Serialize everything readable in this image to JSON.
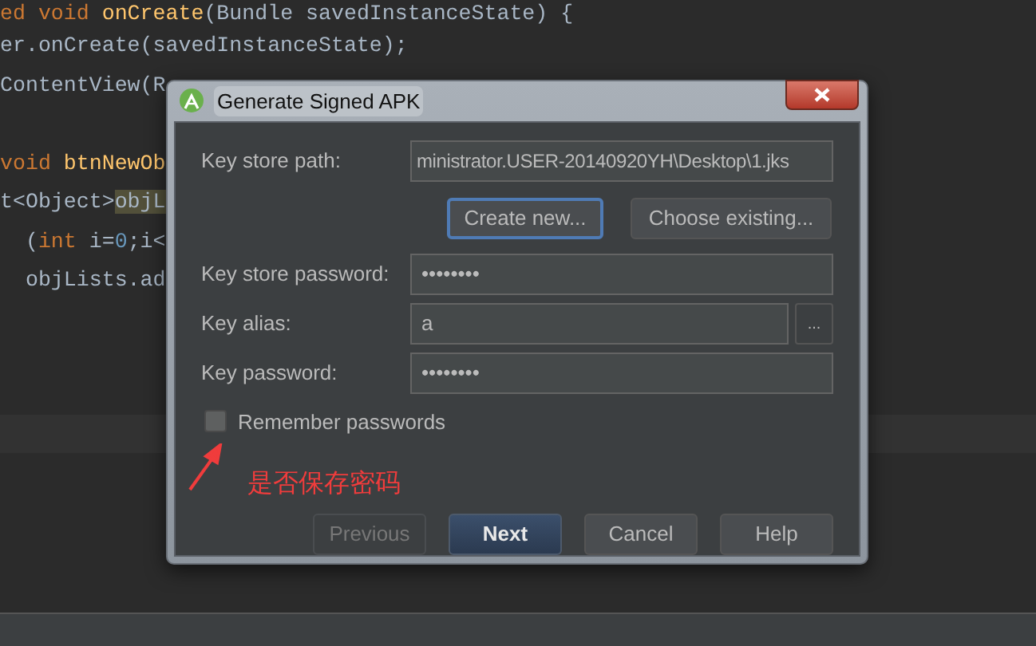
{
  "editor": {
    "lines": [
      {
        "segments": [
          {
            "text": "ed void ",
            "kind": "keyword"
          },
          {
            "text": "onCreate",
            "kind": "method"
          },
          {
            "text": "(Bundle savedInstanceState) {",
            "kind": "plain"
          }
        ]
      },
      {
        "segments": [
          {
            "text": "er.onCreate(savedInstanceState);",
            "kind": "plain"
          }
        ]
      },
      {
        "segments": [
          {
            "text": "ContentView(R",
            "kind": "plain"
          }
        ]
      },
      {
        "kind": "blank"
      },
      {
        "segments": [
          {
            "text": "void ",
            "kind": "keyword"
          },
          {
            "text": "btnNewOb",
            "kind": "method"
          }
        ]
      },
      {
        "segments": [
          {
            "text": "t<Object>",
            "kind": "plain"
          },
          {
            "text": "objL",
            "kind": "highlight"
          }
        ]
      },
      {
        "segments": [
          {
            "text": "  (",
            "kind": "plain"
          },
          {
            "text": "int ",
            "kind": "keyword"
          },
          {
            "text": "i=",
            "kind": "plain"
          },
          {
            "text": "0",
            "kind": "number"
          },
          {
            "text": ";i<",
            "kind": "plain"
          }
        ]
      },
      {
        "segments": [
          {
            "text": "  objLists.ad",
            "kind": "plain"
          }
        ]
      }
    ]
  },
  "dialog": {
    "title": "Generate Signed APK",
    "fields": [
      {
        "kind": "path",
        "label": "Key store path:",
        "value": "ministrator.USER-20140920YH\\Desktop\\1.jks"
      },
      {
        "kind": "actions",
        "buttons": [
          {
            "label": "Create new...",
            "focused": true
          },
          {
            "label": "Choose existing...",
            "focused": false
          }
        ]
      },
      {
        "kind": "text",
        "label": "Key store password:",
        "value": "••••••••"
      },
      {
        "kind": "browse",
        "label": "Key alias:",
        "value": "a",
        "button": "..."
      },
      {
        "kind": "text",
        "label": "Key password:",
        "value": "••••••••"
      }
    ],
    "remember": {
      "label": "Remember passwords",
      "checked": false
    },
    "annotation": "是否保存密码",
    "buttons": [
      {
        "label": "Previous",
        "disabled": true,
        "default": false
      },
      {
        "label": "Next",
        "disabled": false,
        "default": true
      },
      {
        "label": "Cancel",
        "disabled": false,
        "default": false
      },
      {
        "label": "Help",
        "disabled": false,
        "default": false
      }
    ]
  }
}
